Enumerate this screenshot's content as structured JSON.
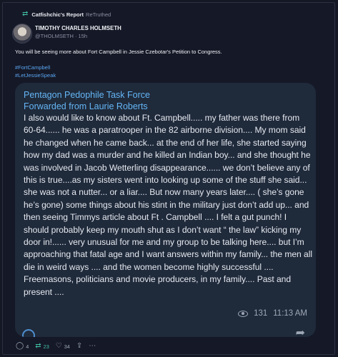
{
  "retruth": {
    "by": "Catfishchic's Report",
    "label": "ReTruthed"
  },
  "author": {
    "name": "TIMOTHY CHARLES HOLMSETH",
    "handle": "@THOLMSETH",
    "time": "15h"
  },
  "post": {
    "text": "You will be seeing more about Fort Campbell in Jessie Czebotar's Petition to Congress.",
    "hashtags": [
      "#FortCampbell",
      "#LetJessieSpeak"
    ]
  },
  "telegram": {
    "title_line1": "Pentagon Pedophile Task Force",
    "title_line2": "Forwarded from Laurie Roberts",
    "text": "I also would like to know about Ft. Campbell..... my father was there from 60-64...... he was a paratrooper in the 82 airborne division.... My mom said he changed when he came back... at the end of her life, she started saying how my dad was a murder and he killed an Indian boy... and she thought he was involved in Jacob Wetterling disappearance...... we don’t  believe  any of this is true....as my sisters went into looking up some of the stuff she said... she was not a nutter... or a liar.... But now many years later.... ( she’s gone he’s gone) some things about his stint in the military just don’t add up... and then seeing Timmys article about Ft . Campbell .... I felt a gut punch! I should probably keep my mouth shut as I don’t want “ the law” kicking my door in!...... very unusual for me and my group to be talking here....  but I’m approaching that fatal age and I want answers within my family... the men all die in weird ways .... and the women become highly successful .... Freemasons, politicians and movie producers, in my family.... Past and present ....",
    "views": "131",
    "time": "11:13 AM"
  },
  "actions": {
    "replies": "4",
    "retruths": "23",
    "likes": "34"
  },
  "colors": {
    "accent": "#42c3a8",
    "link": "#5aa6f2",
    "tg_title": "#65b6f5",
    "background": "#141724",
    "card": "#1f2a3b"
  }
}
